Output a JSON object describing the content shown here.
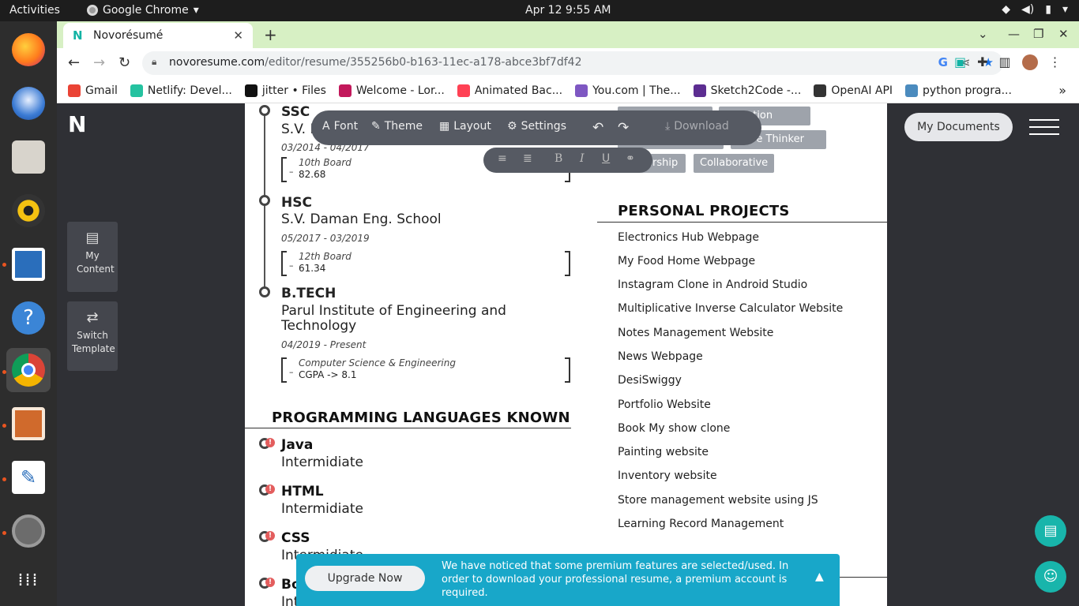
{
  "topbar": {
    "activities": "Activities",
    "app_name": "Google Chrome",
    "clock": "Apr 12  9:55 AM"
  },
  "browser": {
    "tab_title": "Novorésumé",
    "url_host": "novoresume.com",
    "url_path": "/editor/resume/355256b0-b163-11ec-a178-abce3bf7df42",
    "bookmarks": [
      {
        "label": "Gmail",
        "color": "#ea4335"
      },
      {
        "label": "Netlify: Devel...",
        "color": "#25c2a0"
      },
      {
        "label": "jitter • Files",
        "color": "#111111"
      },
      {
        "label": "Welcome - Lor...",
        "color": "#c2185b"
      },
      {
        "label": "Animated Bac...",
        "color": "#ff4154"
      },
      {
        "label": "You.com | The...",
        "color": "#7e57c2"
      },
      {
        "label": "Sketch2Code -...",
        "color": "#5c2d91"
      },
      {
        "label": "OpenAI API",
        "color": "#333333"
      },
      {
        "label": "python progra...",
        "color": "#4b8bbe"
      }
    ]
  },
  "sidebar": {
    "my_content": "My Content",
    "switch_template": "Switch Template"
  },
  "editor_toolbar": {
    "font": "Font",
    "theme": "Theme",
    "layout": "Layout",
    "settings": "Settings",
    "download": "Download"
  },
  "education": [
    {
      "title": "SSC",
      "school": "S.V. P",
      "date": "03/2014 - 04/2017",
      "label": "10th Board",
      "value": "82.68"
    },
    {
      "title": "HSC",
      "school": "S.V. Daman Eng. School",
      "date": "05/2017 - 03/2019",
      "label": "12th Board",
      "value": "61.34"
    },
    {
      "title": "B.TECH",
      "school": "Parul Institute of Engineering and Technology",
      "date": "04/2019 - Present",
      "label": "Computer Science & Engineering",
      "value": "CGPA -> 8.1"
    }
  ],
  "languages_heading": "PROGRAMMING LANGUAGES KNOWN",
  "languages": [
    {
      "name": "Java",
      "level": "Intermidiate"
    },
    {
      "name": "HTML",
      "level": "Intermidiate"
    },
    {
      "name": "CSS",
      "level": "Intermidiate"
    },
    {
      "name": "Bo",
      "level": "Int"
    }
  ],
  "skills_tags": [
    "unication",
    "ative Thinker",
    "ership",
    "Collaborative"
  ],
  "projects_heading": "PERSONAL PROJECTS",
  "projects": [
    "Electronics Hub Webpage",
    "My Food Home Webpage",
    "Instagram Clone in Android Studio",
    "Multiplicative Inverse Calculator Website",
    "Notes Management Website",
    "News Webpage",
    "DesiSwiggy",
    "Portfolio Website",
    "Book My show clone",
    "Painting website",
    "Inventory website",
    "Store management website using JS",
    "Learning Record Management"
  ],
  "right_panel": {
    "my_documents": "My Documents"
  },
  "banner": {
    "button": "Upgrade Now",
    "text": "We have noticed that some premium features are selected/used. In order to download your professional resume, a premium account is required."
  }
}
